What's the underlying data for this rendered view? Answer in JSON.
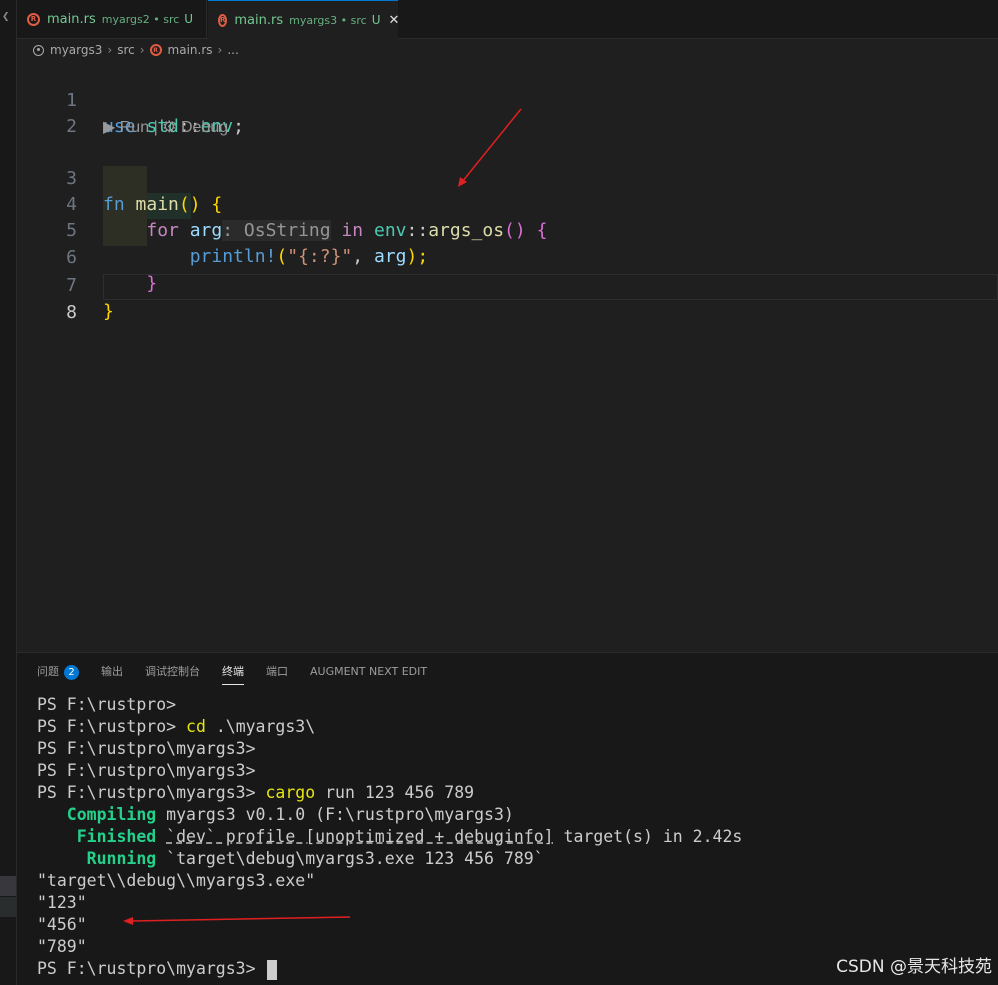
{
  "tabs": [
    {
      "file": "main.rs",
      "desc": "myargs2 • src",
      "status": "U",
      "active": false
    },
    {
      "file": "main.rs",
      "desc": "myargs3 • src",
      "status": "U",
      "active": true,
      "close": "✕"
    }
  ],
  "breadcrumb": [
    "myargs3",
    "src",
    "main.rs",
    "..."
  ],
  "editor": {
    "line_numbers": [
      "1",
      "2",
      "3",
      "4",
      "5",
      "6",
      "7",
      "8"
    ],
    "codelens": {
      "run": "Run",
      "separator": "|",
      "debug": "Debug"
    },
    "tokens": {
      "use": "use",
      "std": "std",
      "sep": "::",
      "env": "env",
      "semi": ";",
      "fn": "fn",
      "main": "main",
      "parens": "()",
      "open_brace": "{",
      "for": "for",
      "arg": "arg",
      "hint_type": ": OsString",
      "in": "in",
      "env2": "env",
      "args_os": "args_os",
      "close_brace": "}",
      "println": "println!",
      "lparen": "(",
      "fmt": "\"{:?}\"",
      "comma": ", ",
      "arg2": "arg",
      "rparen_semi": ");"
    }
  },
  "panel": {
    "tabs": [
      {
        "label": "问题",
        "badge": "2"
      },
      {
        "label": "输出"
      },
      {
        "label": "调试控制台"
      },
      {
        "label": "终端",
        "active": true
      },
      {
        "label": "端口"
      },
      {
        "label": "AUGMENT NEXT EDIT"
      }
    ]
  },
  "terminal": {
    "l1": "PS F:\\rustpro>",
    "l2_prompt": "PS F:\\rustpro> ",
    "l2_cmd": "cd",
    "l2_arg": " .\\myargs3\\",
    "l3": "PS F:\\rustpro\\myargs3>",
    "l4": "PS F:\\rustpro\\myargs3>",
    "l5_prompt": "PS F:\\rustpro\\myargs3> ",
    "l5_cmd": "cargo",
    "l5_arg": " run 123 456 789",
    "l6_label": "   Compiling",
    "l6_text": " myargs3 v0.1.0 (F:\\rustpro\\myargs3)",
    "l7_label": "    Finished",
    "l7_pre": " ",
    "l7_dotted": "`dev` profile [unoptimized + debuginfo]",
    "l7_post": " target(s) in 2.42s",
    "l8_label": "     Running",
    "l8_text": " `target\\debug\\myargs3.exe 123 456 789`",
    "l9": "\"target\\\\debug\\\\myargs3.exe\"",
    "l10": "\"123\"",
    "l11": "\"456\"",
    "l12": "\"789\"",
    "l13": "PS F:\\rustpro\\myargs3> "
  },
  "watermark": "CSDN @景天科技苑",
  "colors": {
    "accent": "#0078d4",
    "annotation": "#e02020",
    "untracked": "#73c991"
  }
}
